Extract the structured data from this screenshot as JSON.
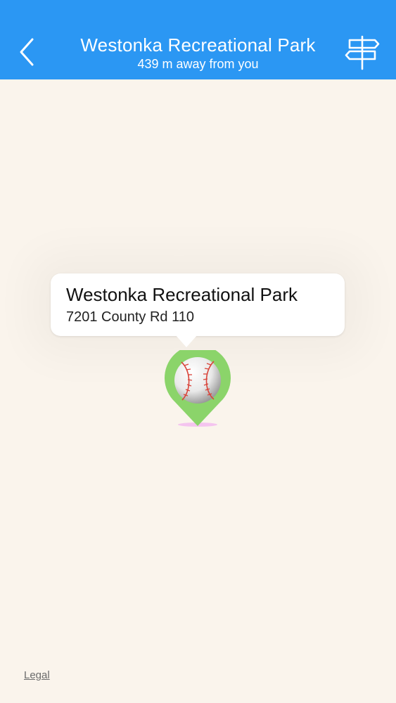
{
  "nav": {
    "title": "Westonka Recreational Park",
    "subtitle": "439 m away from you",
    "back_icon": "chevron-left-icon",
    "directions_icon": "signpost-icon",
    "background_color": "#2b97f3"
  },
  "map": {
    "background_color": "#faf4ec",
    "legal_label": "Legal"
  },
  "callout": {
    "title": "Westonka Recreational Park",
    "address": "7201 County Rd 110"
  },
  "pin": {
    "icon": "baseball-icon",
    "color": "#8bd46a"
  }
}
